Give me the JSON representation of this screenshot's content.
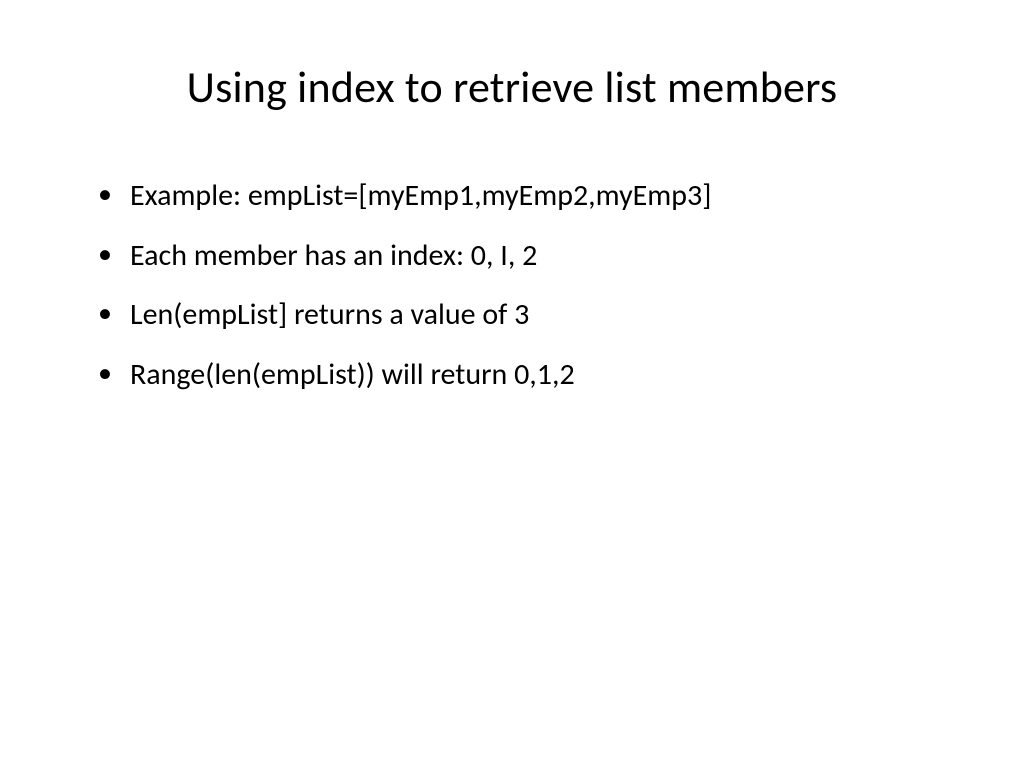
{
  "slide": {
    "title": "Using index to retrieve list members",
    "bullets": [
      "Example: empList=[myEmp1,myEmp2,myEmp3]",
      "Each member has an index: 0, I, 2",
      "Len(empList] returns a value of 3",
      "Range(len(empList)) will return 0,1,2"
    ]
  }
}
